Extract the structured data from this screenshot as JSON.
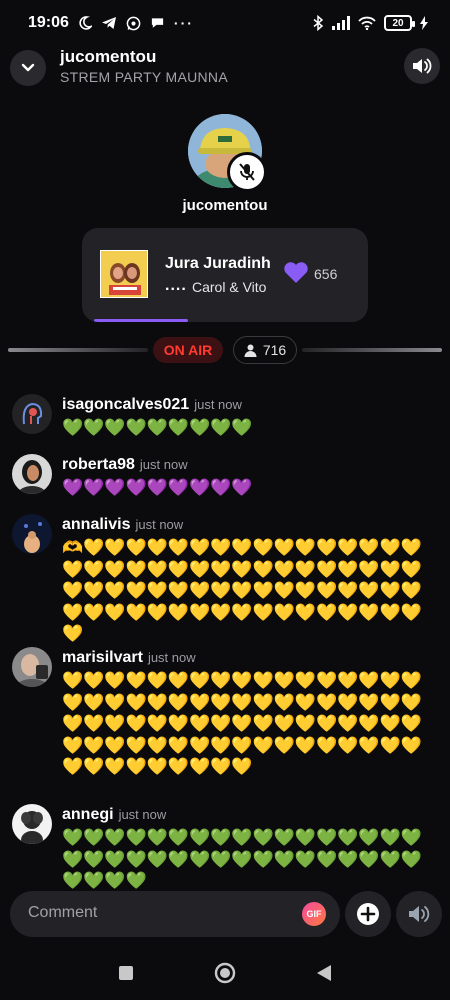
{
  "status_bar": {
    "time": "19:06",
    "battery": "20",
    "icons": [
      "moon-icon",
      "telegram-icon",
      "whatsapp-icon",
      "chat-icon",
      "more-icon",
      "bluetooth-icon",
      "signal-icon",
      "wifi-icon",
      "charging-icon"
    ]
  },
  "header": {
    "title": "jucomentou",
    "subtitle": "STREM PARTY MAUNNA"
  },
  "host": {
    "name": "jucomentou",
    "muted": true
  },
  "now_playing": {
    "title": "Jura Juradinh",
    "dots": "....",
    "artist": "Carol & Vito",
    "likes": "656",
    "progress": 0.33,
    "accent": "#8a5cf6"
  },
  "live": {
    "on_air_label": "ON AIR",
    "listeners": "716"
  },
  "comments": [
    {
      "user": "isagoncalves021",
      "time": "just now",
      "text": "💚💚💚💚💚💚💚💚💚",
      "color": "green"
    },
    {
      "user": "roberta98",
      "time": "just now",
      "text": "💜💜💜💜💜💜💜💜💜",
      "color": "purple"
    },
    {
      "user": "annalivis",
      "time": "just now",
      "text": "🫶💛💛💛💛💛💛💛💛💛💛💛💛💛💛💛💛💛💛💛💛💛💛💛💛💛💛💛💛💛💛💛💛💛💛💛💛💛💛💛💛💛💛💛💛💛💛💛💛💛💛💛💛💛💛💛💛💛💛💛💛💛💛💛💛💛💛💛💛",
      "color": "yellow"
    },
    {
      "user": "marisilvart",
      "time": "just now",
      "text": "💛💛💛💛💛💛💛💛💛💛💛💛💛💛💛💛💛💛💛💛💛💛💛💛💛💛💛💛💛💛💛💛💛💛💛💛💛💛💛💛💛💛💛💛💛💛💛💛💛💛💛💛💛💛💛💛💛💛💛💛💛💛💛💛💛💛💛💛💛💛💛💛💛💛💛💛💛",
      "color": "yellow"
    },
    {
      "user": "annegi",
      "time": "just now",
      "text": "💚💚💚💚💚💚💚💚💚💚💚💚💚💚💚💚💚💚💚💚💚💚💚💚💚💚💚💚💚💚💚💚💚💚💚💚💚💚",
      "color": "green"
    }
  ],
  "composer": {
    "placeholder": "Comment",
    "gif_label": "GIF"
  },
  "colors": {
    "background": "#0b0b0d",
    "on_air_red": "#ff3b30",
    "heart_purple": "#8a5cf6"
  }
}
